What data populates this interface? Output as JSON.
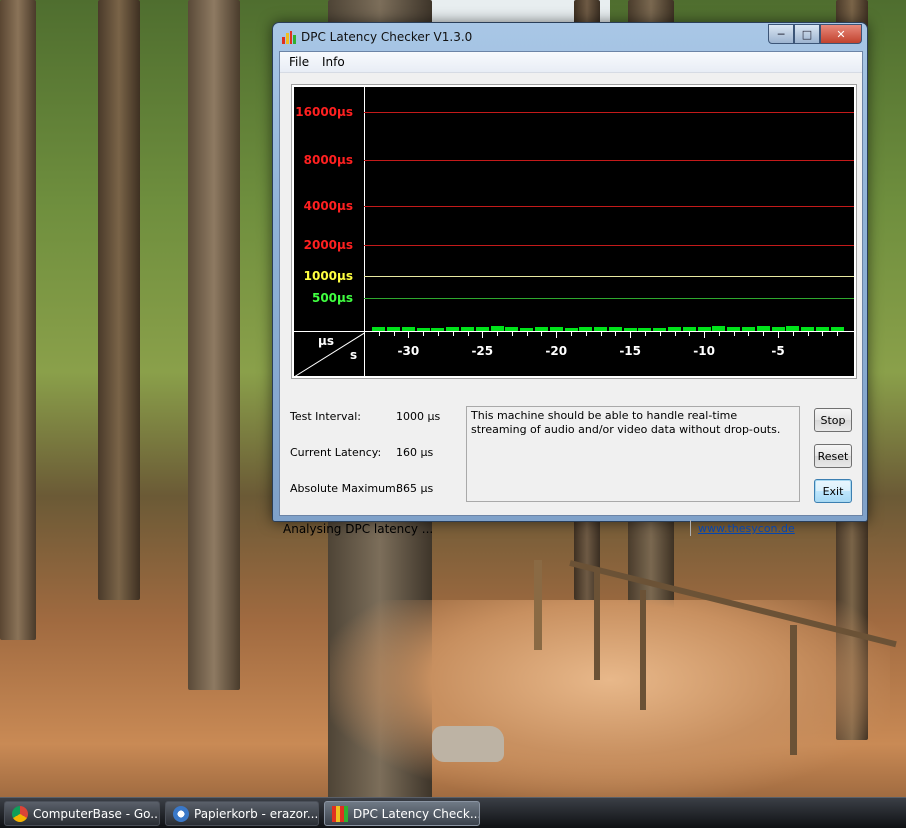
{
  "window": {
    "title": "DPC Latency Checker V1.3.0",
    "menu": [
      "File",
      "Info"
    ]
  },
  "chart_data": {
    "type": "bar",
    "yticks": [
      "16000µs",
      "8000µs",
      "4000µs",
      "2000µs",
      "1000µs",
      "500µs"
    ],
    "ytick_colors": [
      "#ff2020",
      "#ff2020",
      "#ff2020",
      "#ff2020",
      "#ffff40",
      "#40ff40"
    ],
    "corner_label_us": "µs",
    "corner_label_s": "s",
    "xticks": [
      "-30",
      "-25",
      "-20",
      "-15",
      "-10",
      "-5"
    ],
    "x": [
      -32,
      -31,
      -30,
      -29,
      -28,
      -27,
      -26,
      -25,
      -24,
      -23,
      -22,
      -21,
      -20,
      -19,
      -18,
      -17,
      -16,
      -15,
      -14,
      -13,
      -12,
      -11,
      -10,
      -9,
      -8,
      -7,
      -6,
      -5,
      -4,
      -3,
      -2,
      -1
    ],
    "values": [
      160,
      160,
      150,
      140,
      130,
      170,
      160,
      150,
      210,
      160,
      120,
      160,
      160,
      140,
      150,
      180,
      160,
      120,
      130,
      140,
      160,
      150,
      160,
      210,
      160,
      150,
      190,
      160,
      190,
      160,
      150,
      160
    ],
    "bar_color": "#00e31a"
  },
  "info": {
    "test_interval_label": "Test Interval:",
    "test_interval_value": "1000 µs",
    "current_latency_label": "Current Latency:",
    "current_latency_value": "160 µs",
    "absolute_maximum_label": "Absolute Maximum:",
    "absolute_maximum_value": "865 µs",
    "message": "This machine should be able to handle real-time streaming of audio and/or video data without drop-outs."
  },
  "buttons": {
    "stop": "Stop",
    "reset": "Reset",
    "exit": "Exit"
  },
  "status": {
    "text": "Analysing DPC latency ...",
    "link": "www.thesycon.de"
  },
  "taskbar": [
    {
      "label": "ComputerBase - Go...",
      "icon": "chrome-icon",
      "active": false
    },
    {
      "label": "Papierkorb - erazor...",
      "icon": "recycle-bin-icon",
      "active": false
    },
    {
      "label": "DPC Latency Check...",
      "icon": "dpc-app-icon",
      "active": true
    }
  ]
}
